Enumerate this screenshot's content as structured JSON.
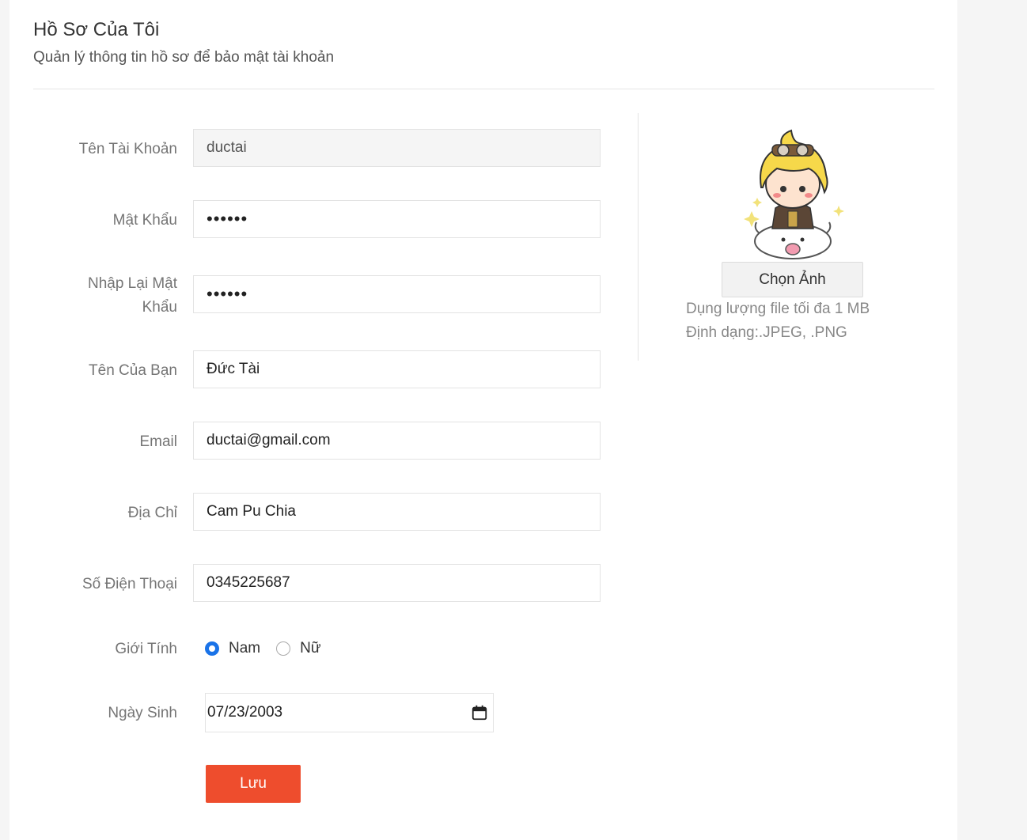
{
  "header": {
    "title": "Hồ Sơ Của Tôi",
    "subtitle": "Quản lý thông tin hồ sơ để bảo mật tài khoản"
  },
  "form": {
    "username": {
      "label": "Tên Tài Khoản",
      "value": "ductai"
    },
    "password": {
      "label": "Mật Khẩu",
      "value": "••••••"
    },
    "confirm_password": {
      "label_line1": "Nhập Lại Mật",
      "label_line2": "Khẩu",
      "value": "••••••"
    },
    "name": {
      "label": "Tên Của Bạn",
      "value": "Đức Tài"
    },
    "email": {
      "label": "Email",
      "value": "ductai@gmail.com"
    },
    "address": {
      "label": "Địa Chỉ",
      "value": "Cam Pu Chia"
    },
    "phone": {
      "label": "Số Điện Thoại",
      "value": "0345225687"
    },
    "gender": {
      "label": "Giới Tính",
      "options": [
        "Nam",
        "Nữ"
      ],
      "selected": "Nam"
    },
    "birthday": {
      "label": "Ngày Sinh",
      "value": "07/23/2003"
    },
    "save_label": "Lưu"
  },
  "avatar_panel": {
    "choose_label": "Chọn Ảnh",
    "size_note": "Dụng lượng file tối đa 1 MB",
    "format_note": "Định dạng:.JPEG, .PNG"
  },
  "colors": {
    "accent": "#ee4d2d",
    "radio_selected": "#1a73e8"
  }
}
